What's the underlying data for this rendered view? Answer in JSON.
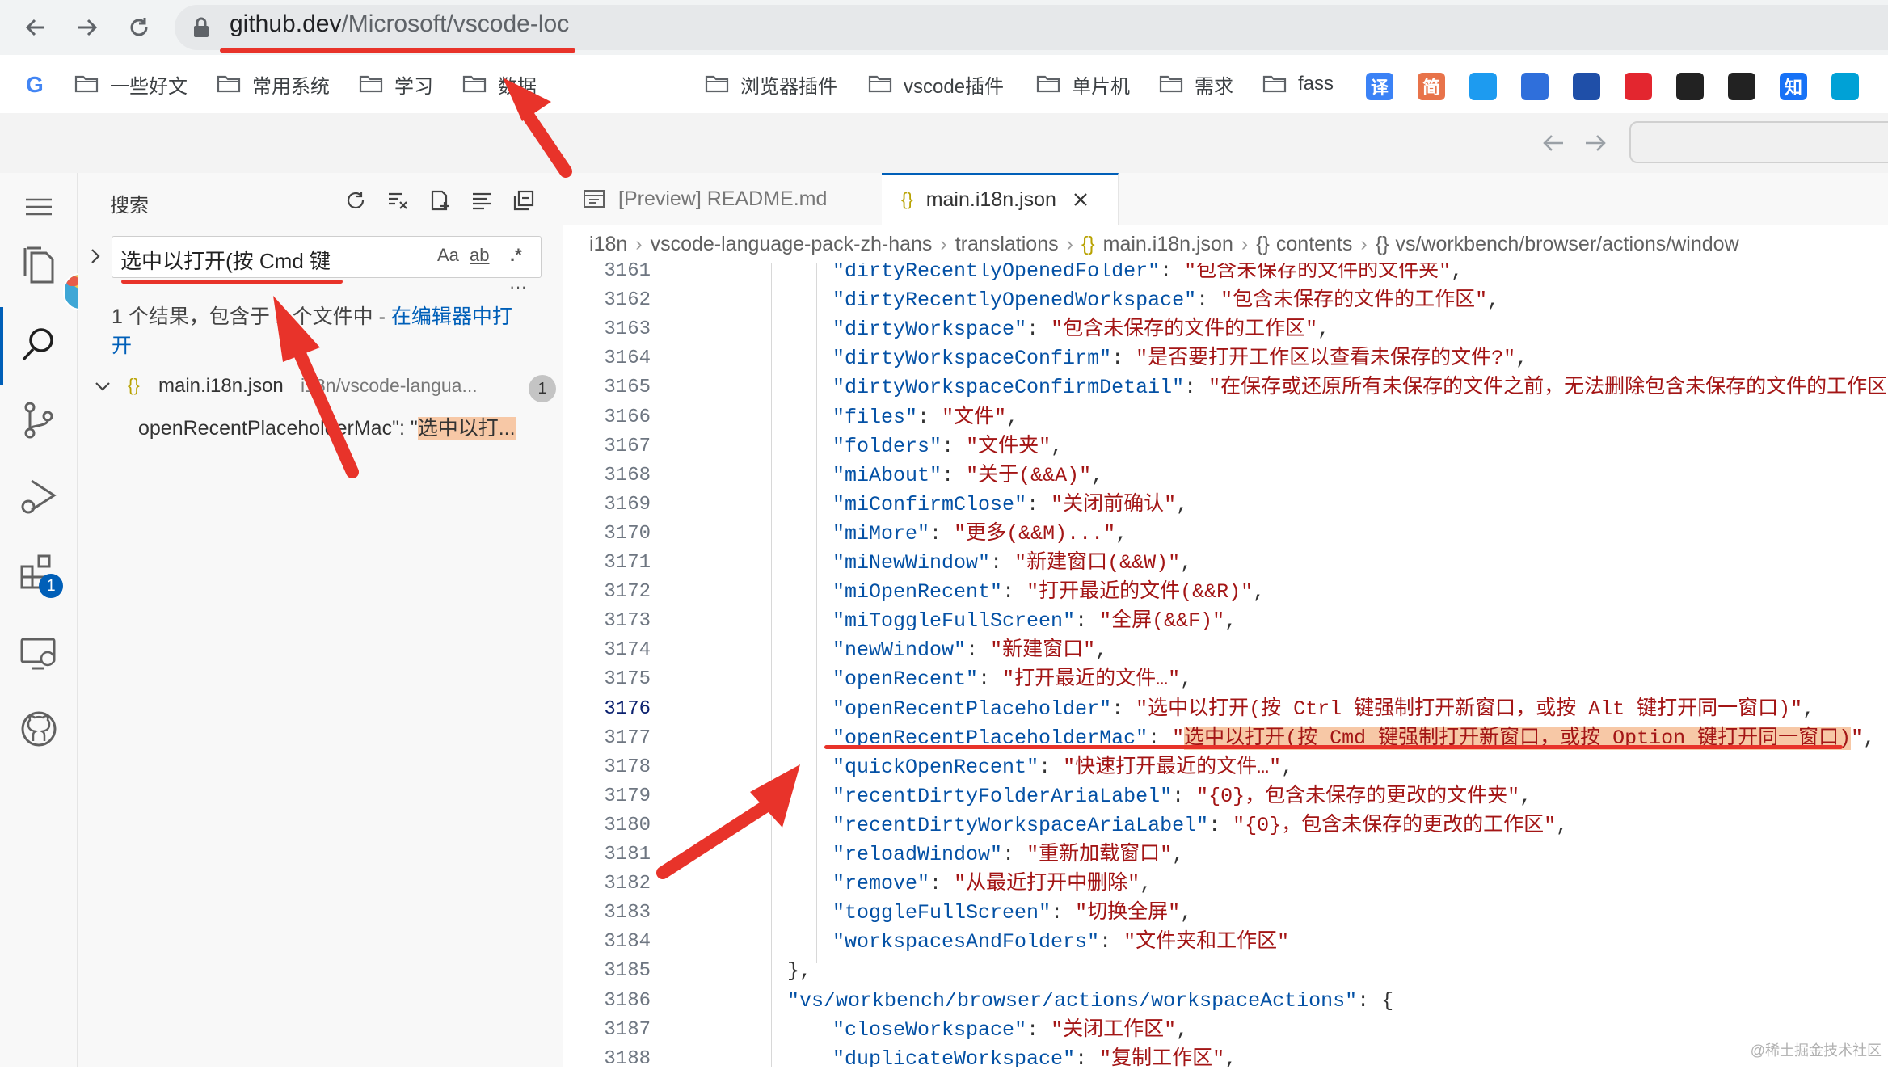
{
  "browser": {
    "url_domain": "github.dev",
    "url_path": "/Microsoft/vscode-loc",
    "bookmarks": [
      {
        "label": "一些好文"
      },
      {
        "label": "常用系统"
      },
      {
        "label": "学习"
      },
      {
        "label": "数据"
      },
      {
        "label": "浏览器插件"
      },
      {
        "label": "vscode插件"
      },
      {
        "label": "单片机"
      },
      {
        "label": "需求"
      },
      {
        "label": "fass"
      }
    ],
    "bookmark_icons": [
      {
        "name": "translate-icon",
        "text": "译",
        "color": "#3b82f6"
      },
      {
        "name": "simplified-icon",
        "text": "简",
        "color": "#e8734a"
      },
      {
        "name": "bird-icon",
        "text": "",
        "color": "#1d9bf0"
      },
      {
        "name": "layers-icon",
        "text": "",
        "color": "#2f6fdb"
      },
      {
        "name": "m-icon",
        "text": "",
        "color": "#1f4fa8"
      },
      {
        "name": "n-icon",
        "text": "",
        "color": "#e3262f"
      },
      {
        "name": "github-icon",
        "text": "",
        "color": "#222222"
      },
      {
        "name": "c-icon",
        "text": "",
        "color": "#222222"
      },
      {
        "name": "zhihu-icon",
        "text": "知",
        "color": "#1772f6"
      },
      {
        "name": "bilibili-icon",
        "text": "",
        "color": "#00a1d6"
      }
    ]
  },
  "sidebar": {
    "title": "搜索",
    "search_value": "选中以打开(按 Cmd 键",
    "opt_case": "Aa",
    "opt_word": "ab",
    "opt_regex": ".*",
    "more": "···",
    "summary_prefix": "1 个结果，包含于 1 个文件中 - ",
    "summary_link": "在编辑器中打开",
    "result_file": "main.i18n.json",
    "result_path": "i18n/vscode-langua...",
    "result_count": "1",
    "match_prefix": "openRecentPlaceholderMac\": \"",
    "match_highlight": "选中以打..."
  },
  "activity": {
    "extensions_badge": "1"
  },
  "editor": {
    "tabs": [
      {
        "label": "[Preview] README.md"
      },
      {
        "label": "main.i18n.json"
      }
    ],
    "breadcrumbs": [
      "i18n",
      "vscode-language-pack-zh-hans",
      "translations",
      "main.i18n.json",
      "contents",
      "vs/workbench/browser/actions/window"
    ],
    "lines": [
      {
        "n": "3161",
        "indent": 2,
        "k": "dirtyRecentlyOpenedFolder",
        "v": "包含未保存的文件的文件夹",
        "tail": ","
      },
      {
        "n": "3162",
        "indent": 2,
        "k": "dirtyRecentlyOpenedWorkspace",
        "v": "包含未保存的文件的工作区",
        "tail": ","
      },
      {
        "n": "3163",
        "indent": 2,
        "k": "dirtyWorkspace",
        "v": "包含未保存的文件的工作区",
        "tail": ","
      },
      {
        "n": "3164",
        "indent": 2,
        "k": "dirtyWorkspaceConfirm",
        "v": "是否要打开工作区以查看未保存的文件?",
        "tail": ","
      },
      {
        "n": "3165",
        "indent": 2,
        "k": "dirtyWorkspaceConfirmDetail",
        "v": "在保存或还原所有未保存的文件之前，无法删除包含未保存的文件的工作区。",
        "tail": ","
      },
      {
        "n": "3166",
        "indent": 2,
        "k": "files",
        "v": "文件",
        "tail": ","
      },
      {
        "n": "3167",
        "indent": 2,
        "k": "folders",
        "v": "文件夹",
        "tail": ","
      },
      {
        "n": "3168",
        "indent": 2,
        "k": "miAbout",
        "v": "关于(&&A)",
        "tail": ","
      },
      {
        "n": "3169",
        "indent": 2,
        "k": "miConfirmClose",
        "v": "关闭前确认",
        "tail": ","
      },
      {
        "n": "3170",
        "indent": 2,
        "k": "miMore",
        "v": "更多(&&M)...",
        "tail": ","
      },
      {
        "n": "3171",
        "indent": 2,
        "k": "miNewWindow",
        "v": "新建窗口(&&W)",
        "tail": ","
      },
      {
        "n": "3172",
        "indent": 2,
        "k": "miOpenRecent",
        "v": "打开最近的文件(&&R)",
        "tail": ","
      },
      {
        "n": "3173",
        "indent": 2,
        "k": "miToggleFullScreen",
        "v": "全屏(&&F)",
        "tail": ","
      },
      {
        "n": "3174",
        "indent": 2,
        "k": "newWindow",
        "v": "新建窗口",
        "tail": ","
      },
      {
        "n": "3175",
        "indent": 2,
        "k": "openRecent",
        "v": "打开最近的文件…",
        "tail": ","
      },
      {
        "n": "3176",
        "indent": 2,
        "k": "openRecentPlaceholder",
        "v": "选中以打开(按 Ctrl 键强制打开新窗口，或按 Alt 键打开同一窗口)",
        "tail": ","
      },
      {
        "n": "3177",
        "indent": 2,
        "k": "openRecentPlaceholderMac",
        "v": "选中以打开(按 Cmd 键强制打开新窗口，或按 Option 键打开同一窗口)",
        "tail": ",",
        "highlight": true
      },
      {
        "n": "3178",
        "indent": 2,
        "k": "quickOpenRecent",
        "v": "快速打开最近的文件…",
        "tail": ","
      },
      {
        "n": "3179",
        "indent": 2,
        "k": "recentDirtyFolderAriaLabel",
        "v": "{0}，包含未保存的更改的文件夹",
        "tail": ","
      },
      {
        "n": "3180",
        "indent": 2,
        "k": "recentDirtyWorkspaceAriaLabel",
        "v": "{0}，包含未保存的更改的工作区",
        "tail": ","
      },
      {
        "n": "3181",
        "indent": 2,
        "k": "reloadWindow",
        "v": "重新加载窗口",
        "tail": ","
      },
      {
        "n": "3182",
        "indent": 2,
        "k": "remove",
        "v": "从最近打开中删除",
        "tail": ","
      },
      {
        "n": "3183",
        "indent": 2,
        "k": "toggleFullScreen",
        "v": "切换全屏",
        "tail": ","
      },
      {
        "n": "3184",
        "indent": 2,
        "k": "workspacesAndFolders",
        "v": "文件夹和工作区",
        "tail": ""
      },
      {
        "n": "3185",
        "indent": 1,
        "raw": "},"
      },
      {
        "n": "3186",
        "indent": 1,
        "k": "vs/workbench/browser/actions/workspaceActions",
        "rawtail": ": {"
      },
      {
        "n": "3187",
        "indent": 2,
        "k": "closeWorkspace",
        "v": "关闭工作区",
        "tail": ","
      },
      {
        "n": "3188",
        "indent": 2,
        "k": "duplicateWorkspace",
        "v": "复制工作区",
        "tail": ","
      }
    ],
    "active_line": "3176"
  },
  "watermark": "@稀土掘金技术社区"
}
